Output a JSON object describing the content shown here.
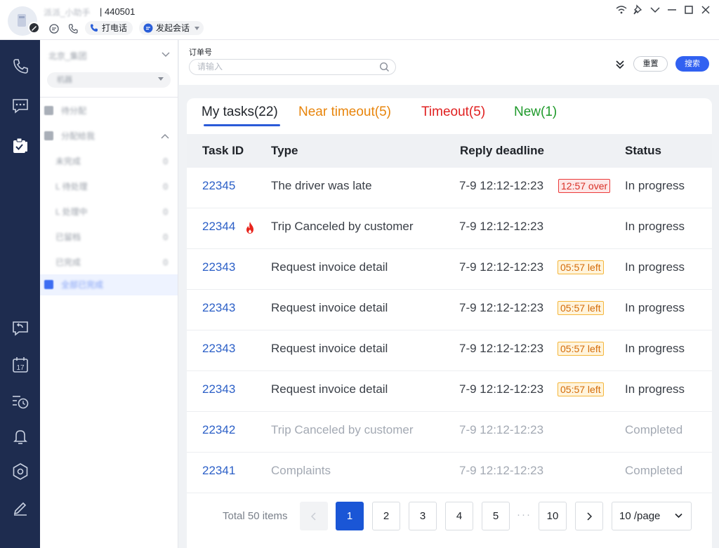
{
  "header": {
    "user_name": "派派_小助手",
    "user_id": "| 440501",
    "call_label": "打电话",
    "chat_label": "发起会话"
  },
  "sidebar": {
    "group_title": "北京_集团",
    "select_value": "机器",
    "items": [
      {
        "label": "待分配",
        "count": ""
      },
      {
        "label": "分配给我",
        "count": ""
      },
      {
        "label": "未完成",
        "count": "0"
      },
      {
        "label": "L 待处理",
        "count": "0"
      },
      {
        "label": "L 处理中",
        "count": "0"
      },
      {
        "label": "已留档",
        "count": "0"
      },
      {
        "label": "已完成",
        "count": "0"
      },
      {
        "label": "全部已完成",
        "count": ""
      }
    ]
  },
  "filter": {
    "label": "订单号",
    "placeholder": "请输入",
    "reset_label": "重置",
    "search_label": "搜索"
  },
  "tabs": [
    {
      "label": "My tasks(22)",
      "color": "#1f2329"
    },
    {
      "label": "Near timeout(5)",
      "color": "#e8850c"
    },
    {
      "label": "Timeout(5)",
      "color": "#e02020"
    },
    {
      "label": "New(1)",
      "color": "#1f9a2b"
    }
  ],
  "table": {
    "headers": [
      "Task ID",
      "Type",
      "Reply deadline",
      "Status"
    ],
    "rows": [
      {
        "id": "22345",
        "type": "The driver was late",
        "deadline": "7-9 12:12-12:23",
        "badge": "12:57 over",
        "status": "In progress"
      },
      {
        "id": "22344",
        "type": "Trip Canceled by customer",
        "deadline": "7-9 12:12-12:23",
        "badge": "",
        "status": "In progress"
      },
      {
        "id": "22343",
        "type": "Request invoice detail",
        "deadline": "7-9 12:12-12:23",
        "badge": "05:57 left",
        "status": "In progress"
      },
      {
        "id": "22343",
        "type": "Request invoice detail",
        "deadline": "7-9 12:12-12:23",
        "badge": "05:57 left",
        "status": "In progress"
      },
      {
        "id": "22343",
        "type": "Request invoice detail",
        "deadline": "7-9 12:12-12:23",
        "badge": "05:57 left",
        "status": "In progress"
      },
      {
        "id": "22343",
        "type": "Request invoice detail",
        "deadline": "7-9 12:12-12:23",
        "badge": "05:57 left",
        "status": "In progress"
      },
      {
        "id": "22342",
        "type": "Trip Canceled by customer",
        "deadline": "7-9 12:12-12:23",
        "badge": "",
        "status": "Completed"
      },
      {
        "id": "22341",
        "type": "Complaints",
        "deadline": "7-9 12:12-12:23",
        "badge": "",
        "status": "Completed"
      }
    ]
  },
  "pagination": {
    "total": "Total 50 items",
    "pages": [
      "1",
      "2",
      "3",
      "4",
      "5",
      "10"
    ],
    "ellipsis": "···",
    "page_size": "10 /page"
  }
}
